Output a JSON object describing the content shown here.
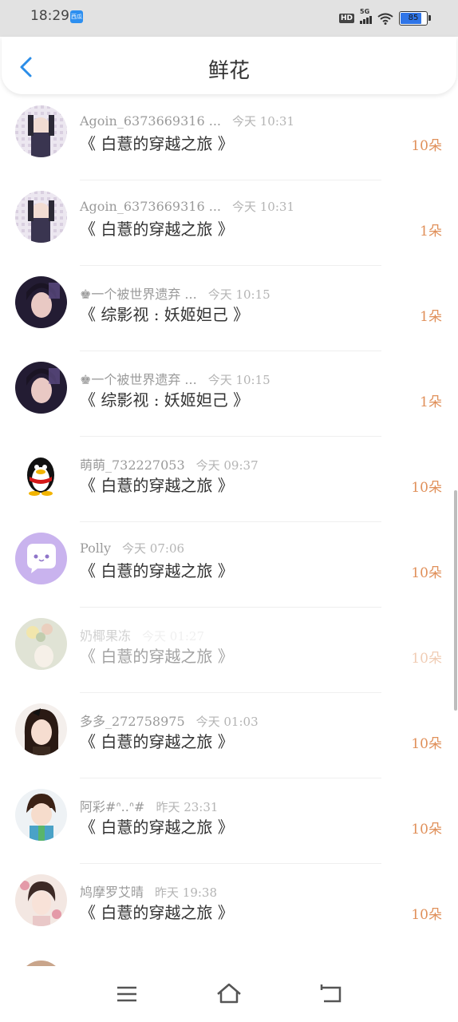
{
  "status_bar": {
    "time": "18:29",
    "app_badge": "西瓜",
    "hd": "HD",
    "network": "5G",
    "battery": "85",
    "battery_level": 0.85,
    "battery_color": "#2f75e8"
  },
  "header": {
    "title": "鲜花",
    "back_icon": "chevron-left-icon",
    "accent": "#2b8de8"
  },
  "list": [
    {
      "name": "Agoin_6373669316 ...",
      "time": "今天 10:31",
      "book": "《 白薏的穿越之旅 》",
      "count": "10朵"
    },
    {
      "name": "Agoin_6373669316 ...",
      "time": "今天 10:31",
      "book": "《 白薏的穿越之旅 》",
      "count": "1朵"
    },
    {
      "name": "♚一个被世界遗弃 ...",
      "time": "今天 10:15",
      "book": "《 综影视 : 妖姬妲己 》",
      "count": "1朵"
    },
    {
      "name": "♚一个被世界遗弃 ...",
      "time": "今天 10:15",
      "book": "《 综影视 : 妖姬妲己 》",
      "count": "1朵"
    },
    {
      "name": "萌萌_732227053",
      "time": "今天 09:37",
      "book": "《 白薏的穿越之旅 》",
      "count": "10朵"
    },
    {
      "name": "Polly",
      "time": "今天 07:06",
      "book": "《 白薏的穿越之旅 》",
      "count": "10朵"
    },
    {
      "name": "奶椰果冻",
      "time": "今天 01:27",
      "book": "《 白薏的穿越之旅 》",
      "count": "10朵"
    },
    {
      "name": "多多_272758975",
      "time": "今天 01:03",
      "book": "《 白薏的穿越之旅 》",
      "count": "10朵"
    },
    {
      "name": "阿彩#ᐢ..ᐢ#",
      "time": "昨天 23:31",
      "book": "《 白薏的穿越之旅 》",
      "count": "10朵"
    },
    {
      "name": "鸠摩罗艾晴",
      "time": "昨天 19:38",
      "book": "《 白薏的穿越之旅 》",
      "count": "10朵"
    }
  ],
  "colors": {
    "count": "#e0905a",
    "name": "#9a9a9a",
    "book": "#333333"
  },
  "nav_bar": {
    "icons": [
      "menu-icon",
      "home-icon",
      "back-icon"
    ]
  }
}
